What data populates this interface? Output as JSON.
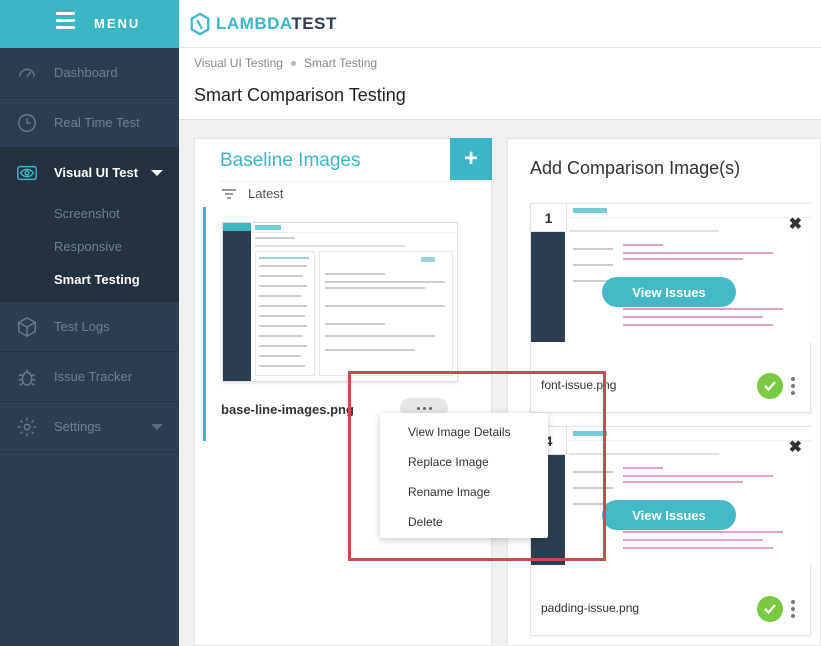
{
  "sidebar": {
    "menu_label": "MENU",
    "items": [
      {
        "label": "Dashboard",
        "icon": "gauge-icon"
      },
      {
        "label": "Real Time Test",
        "icon": "clock-icon"
      },
      {
        "label": "Visual UI Test",
        "icon": "eye-icon",
        "active": true
      },
      {
        "label": "Test Logs",
        "icon": "cube-icon"
      },
      {
        "label": "Issue Tracker",
        "icon": "bug-icon"
      },
      {
        "label": "Settings",
        "icon": "gear-icon"
      }
    ],
    "sub_items": [
      {
        "label": "Screenshot"
      },
      {
        "label": "Responsive"
      },
      {
        "label": "Smart Testing",
        "active": true
      }
    ]
  },
  "header": {
    "logo_part1": "LAMBDA",
    "logo_part2": "TEST"
  },
  "breadcrumb": {
    "items": [
      "Visual UI Testing",
      "Smart Testing"
    ]
  },
  "page": {
    "title": "Smart Comparison Testing"
  },
  "baseline": {
    "title": "Baseline Images",
    "add_label": "+",
    "sort_label": "Latest",
    "image_name": "base-line-images.png"
  },
  "context_menu": {
    "items": [
      "View Image Details",
      "Replace Image",
      "Rename Image",
      "Delete"
    ]
  },
  "comparison": {
    "title": "Add Comparison Image(s)",
    "cards": [
      {
        "number": "1",
        "button": "View Issues",
        "filename": "font-issue.png",
        "close": "✖"
      },
      {
        "number": "4",
        "button": "View Issues",
        "filename": "padding-issue.png",
        "close": "✖"
      }
    ]
  },
  "colors": {
    "accent": "#3cb6c5",
    "sidebar": "#2d3e50",
    "success": "#7ac943",
    "highlight": "#c94a4f"
  }
}
